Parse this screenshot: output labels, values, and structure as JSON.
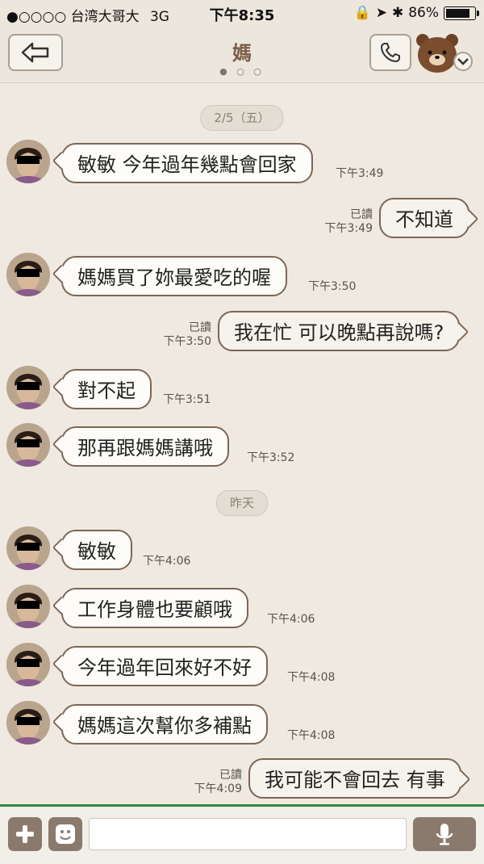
{
  "status": {
    "carrier": "●○○○○ 台湾大哥大",
    "network": "3G",
    "time": "下午8:35",
    "battery": "86%",
    "battery_level": 0.86
  },
  "nav": {
    "title": "媽",
    "page_dots": "● ○ ○"
  },
  "dates": {
    "d1": "2/5（五）",
    "d2": "昨天"
  },
  "messages": [
    {
      "side": "in",
      "text": "敏敏 今年過年幾點會回家",
      "time": "下午3:49"
    },
    {
      "side": "out",
      "text": "不知道",
      "read": "已讀",
      "time": "下午3:49"
    },
    {
      "side": "in",
      "text": "媽媽買了妳最愛吃的喔",
      "time": "下午3:50"
    },
    {
      "side": "out",
      "text": "我在忙 可以晚點再說嗎?",
      "read": "已讀",
      "time": "下午3:50"
    },
    {
      "side": "in",
      "text": "對不起",
      "time": "下午3:51"
    },
    {
      "side": "in",
      "text": "那再跟媽媽講哦",
      "time": "下午3:52"
    },
    {
      "side": "in",
      "text": "敏敏",
      "time": "下午4:06"
    },
    {
      "side": "in",
      "text": "工作身體也要顧哦",
      "time": "下午4:06"
    },
    {
      "side": "in",
      "text": "今年過年回來好不好",
      "time": "下午4:08"
    },
    {
      "side": "in",
      "text": "媽媽這次幫你多補點",
      "time": "下午4:08"
    },
    {
      "side": "out",
      "text": "我可能不會回去 有事",
      "read": "已讀",
      "time": "下午4:09"
    }
  ],
  "input": {
    "value": "",
    "placeholder": ""
  },
  "icons": {
    "back": "back-arrow-icon",
    "call": "phone-icon",
    "sticker": "bear-sticker-icon",
    "add": "plus-icon",
    "emoji": "smiley-icon",
    "mic": "microphone-icon"
  }
}
